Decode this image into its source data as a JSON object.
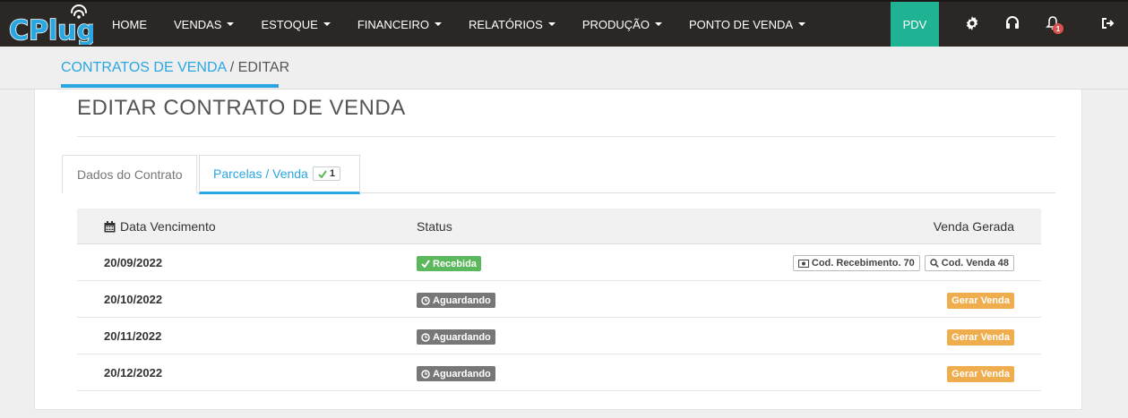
{
  "brand": {
    "logo_text": "CPlug",
    "accent": "#2aa6e0"
  },
  "nav": {
    "items": [
      {
        "label": "HOME",
        "dropdown": false
      },
      {
        "label": "VENDAS",
        "dropdown": true
      },
      {
        "label": "ESTOQUE",
        "dropdown": true
      },
      {
        "label": "FINANCEIRO",
        "dropdown": true
      },
      {
        "label": "RELATÓRIOS",
        "dropdown": true
      },
      {
        "label": "PRODUÇÃO",
        "dropdown": true
      },
      {
        "label": "PONTO DE VENDA",
        "dropdown": true
      }
    ],
    "pdv_label": "PDV",
    "pdv_color": "#1fb393",
    "icons": [
      "gear-icon",
      "headset-icon",
      "bell-icon",
      "logout-icon"
    ],
    "notification_count": "1"
  },
  "breadcrumb": {
    "parent": "CONTRATOS DE VENDA",
    "separator": " / ",
    "current": "EDITAR"
  },
  "page": {
    "title": "EDITAR CONTRATO DE VENDA"
  },
  "tabs": {
    "dados": "Dados do Contrato",
    "parcelas": "Parcelas / Venda",
    "parcelas_count": "1"
  },
  "table": {
    "headers": {
      "date": "Data Vencimento",
      "status": "Status",
      "venda": "Venda Gerada"
    },
    "rows": [
      {
        "date": "20/09/2022",
        "status": "Recebida",
        "status_type": "ok",
        "receb_label": "Cod. Recebimento. 70",
        "venda_label": "Cod. Venda 48"
      },
      {
        "date": "20/10/2022",
        "status": "Aguardando",
        "status_type": "wait",
        "action_label": "Gerar Venda"
      },
      {
        "date": "20/11/2022",
        "status": "Aguardando",
        "status_type": "wait",
        "action_label": "Gerar Venda"
      },
      {
        "date": "20/12/2022",
        "status": "Aguardando",
        "status_type": "wait",
        "action_label": "Gerar Venda"
      }
    ]
  },
  "colors": {
    "success": "#5cb85c",
    "waiting": "#777777",
    "warning": "#f0ad4e"
  }
}
